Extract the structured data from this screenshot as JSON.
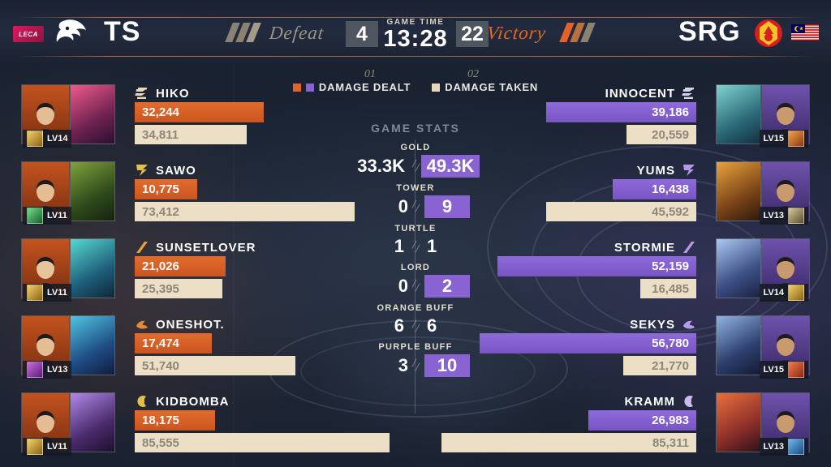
{
  "header": {
    "league_badge": "LECA",
    "left_team": {
      "tag": "TS",
      "logo": "dragon-logo",
      "result": "Defeat",
      "score": "4"
    },
    "right_team": {
      "tag": "SRG",
      "logo": "selangor-crest",
      "flag": "malaysia-flag",
      "result": "Victory",
      "score": "22"
    },
    "game_time_label": "GAME TIME",
    "game_time": "13:28"
  },
  "legend": {
    "game_markers": [
      "01",
      "02"
    ],
    "items": [
      {
        "label": "DAMAGE DEALT",
        "swatches": [
          "#e2622a",
          "#8a63d2"
        ]
      },
      {
        "label": "DAMAGE TAKEN",
        "swatches": [
          "#e6d8bd"
        ]
      }
    ]
  },
  "game_stats": {
    "title": "GAME STATS",
    "rows": [
      {
        "label": "GOLD",
        "left": "33.3K",
        "right": "49.3K",
        "highlight": "right",
        "wide": true
      },
      {
        "label": "TOWER",
        "left": "0",
        "right": "9",
        "highlight": "right",
        "wide": false
      },
      {
        "label": "TURTLE",
        "left": "1",
        "right": "1",
        "highlight": "none",
        "wide": false
      },
      {
        "label": "LORD",
        "left": "0",
        "right": "2",
        "highlight": "right",
        "wide": false
      },
      {
        "label": "ORANGE BUFF",
        "left": "6",
        "right": "6",
        "highlight": "none",
        "wide": false
      },
      {
        "label": "PURPLE BUFF",
        "left": "3",
        "right": "10",
        "highlight": "right",
        "wide": false
      }
    ]
  },
  "left_players": [
    {
      "name": "HIKO",
      "level": "LV14",
      "dealt": "32,244",
      "taken": "34,811",
      "dealt_pct": 37,
      "taken_pct": 32,
      "role_icon": "support-role-icon",
      "hero": "pink-mage-hero",
      "spell": "flicker-spell-icon"
    },
    {
      "name": "SAWO",
      "level": "LV11",
      "dealt": "10,775",
      "taken": "73,412",
      "dealt_pct": 18,
      "taken_pct": 63,
      "role_icon": "exp-role-icon",
      "hero": "green-dragon-hero",
      "spell": "petrify-spell-icon"
    },
    {
      "name": "SUNSETLOVER",
      "level": "LV11",
      "dealt": "21,026",
      "taken": "25,395",
      "dealt_pct": 26,
      "taken_pct": 25,
      "role_icon": "mid-role-icon",
      "hero": "teal-assassin-hero",
      "spell": "flicker-spell-icon"
    },
    {
      "name": "ONESHOT.",
      "level": "LV13",
      "dealt": "17,474",
      "taken": "51,740",
      "dealt_pct": 22,
      "taken_pct": 46,
      "role_icon": "jungle-role-icon",
      "hero": "blue-fighter-hero",
      "spell": "purify-spell-icon"
    },
    {
      "name": "KIDBOMBA",
      "level": "LV11",
      "dealt": "18,175",
      "taken": "85,555",
      "dealt_pct": 23,
      "taken_pct": 73,
      "role_icon": "gold-role-icon",
      "hero": "violet-mage-hero",
      "spell": "flicker-spell-icon"
    }
  ],
  "right_players": [
    {
      "name": "INNOCENT",
      "level": "LV15",
      "dealt": "39,186",
      "taken": "20,559",
      "dealt_pct": 43,
      "taken_pct": 20,
      "role_icon": "support-role-icon",
      "hero": "catgirl-hero",
      "spell": "flameshot-spell-icon"
    },
    {
      "name": "YUMS",
      "level": "LV13",
      "dealt": "16,438",
      "taken": "45,592",
      "dealt_pct": 24,
      "taken_pct": 43,
      "role_icon": "exp-role-icon",
      "hero": "mech-hero",
      "spell": "petrify-spell-icon"
    },
    {
      "name": "STORMIE",
      "level": "LV14",
      "dealt": "52,159",
      "taken": "16,485",
      "dealt_pct": 57,
      "taken_pct": 16,
      "role_icon": "mid-role-icon",
      "hero": "ice-queen-hero",
      "spell": "flicker-spell-icon"
    },
    {
      "name": "SEKYS",
      "level": "LV15",
      "dealt": "56,780",
      "taken": "21,770",
      "dealt_pct": 62,
      "taken_pct": 21,
      "role_icon": "jungle-role-icon",
      "hero": "ninja-hero",
      "spell": "retribution-spell-icon"
    },
    {
      "name": "KRAMM",
      "level": "LV13",
      "dealt": "26,983",
      "taken": "85,311",
      "dealt_pct": 31,
      "taken_pct": 73,
      "role_icon": "gold-role-icon",
      "hero": "redhair-marksman-hero",
      "spell": "inspire-spell-icon"
    }
  ],
  "colors": {
    "dealt_left": "#e2622a",
    "dealt_right": "#8a63d2",
    "taken": "#eddfc6",
    "victory": "#e9671f",
    "defeat": "#9b9486"
  }
}
